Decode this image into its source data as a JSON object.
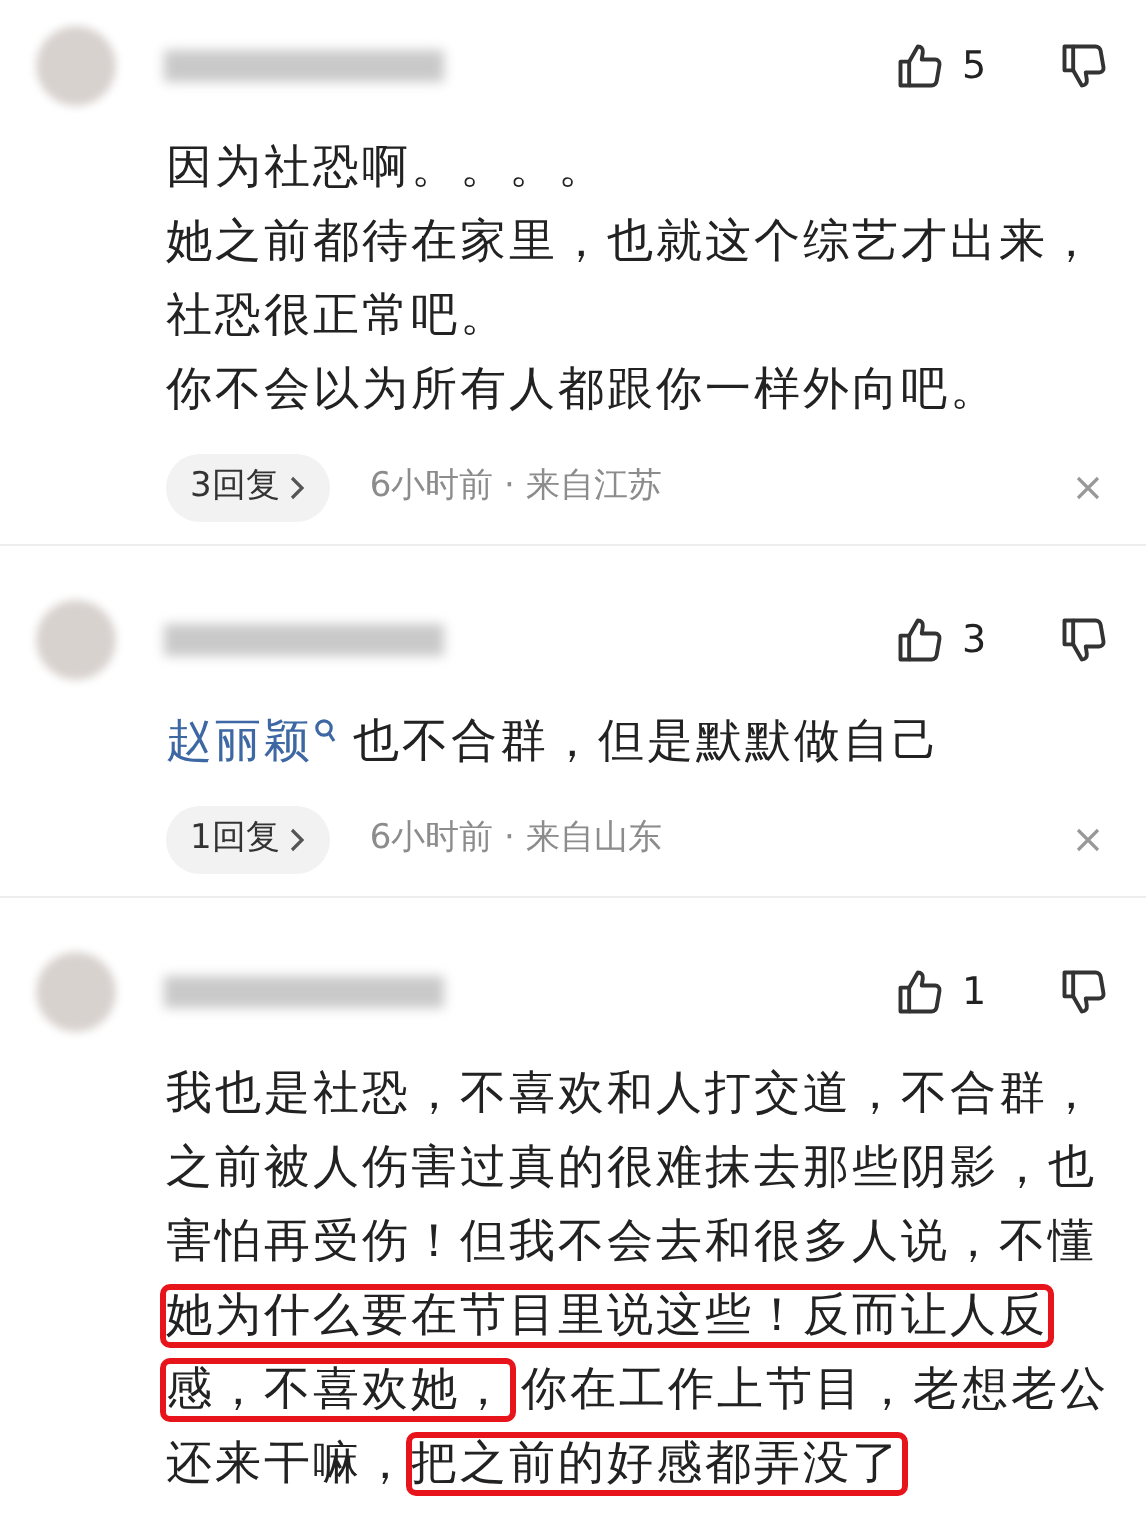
{
  "comments": [
    {
      "likes": "5",
      "body": [
        {
          "kind": "text",
          "text": "因为社恐啊。。。。"
        },
        {
          "kind": "break"
        },
        {
          "kind": "text",
          "text": "她之前都待在家里，也就这个综艺才出来，社恐很正常吧。"
        },
        {
          "kind": "break"
        },
        {
          "kind": "text",
          "text": "你不会以为所有人都跟你一样外向吧。"
        }
      ],
      "replies": "3回复",
      "meta": "6小时前 · 来自江苏"
    },
    {
      "likes": "3",
      "body": [
        {
          "kind": "mention",
          "text": "赵丽颖"
        },
        {
          "kind": "text",
          "text": " 也不合群，但是默默做自己"
        }
      ],
      "replies": "1回复",
      "meta": "6小时前 · 来自山东"
    },
    {
      "likes": "1",
      "body": [
        {
          "kind": "text",
          "text": "我也是社恐，不喜欢和人打交道，不合群，之前被人伤害过真的很难抹去那些阴影，也害怕再受伤！但我不会去和很多人说，不懂"
        },
        {
          "kind": "highlight",
          "text": "她为什么要在节目里说这些！反而让人反感，不喜欢她，"
        },
        {
          "kind": "text",
          "text": "你在工作上节目，老想老公还来干嘛，"
        },
        {
          "kind": "highlight",
          "text": "把之前的好感都弄没了"
        }
      ]
    }
  ]
}
